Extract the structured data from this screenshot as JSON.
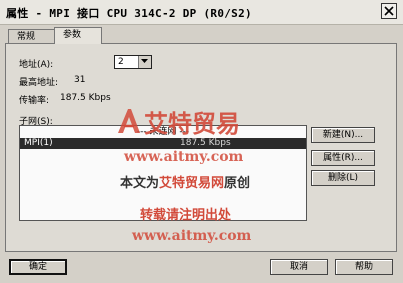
{
  "window": {
    "title": "属性 - MPI 接口  CPU 314C-2 DP (R0/S2)"
  },
  "tabs": [
    {
      "label": "常规"
    },
    {
      "label": "参数"
    }
  ],
  "params": {
    "address_label": "地址(A):",
    "address_value": "2",
    "highest_address_label": "最高地址:",
    "highest_address_value": "31",
    "baud_label": "传输率:",
    "baud_value": "187.5 Kbps",
    "subnet_label": "子网(S):"
  },
  "subnet_list": {
    "rows": [
      {
        "name": "--- 未连网 ---",
        "speed": ""
      },
      {
        "name": "MPI(1)",
        "speed": "187.5 Kbps"
      }
    ],
    "selected_index": 1
  },
  "side_buttons": {
    "new": "新建(N)...",
    "properties": "属性(R)...",
    "delete": "删除(L)"
  },
  "footer": {
    "ok": "确定",
    "cancel": "取消",
    "help": "帮助"
  },
  "watermark": {
    "brand": "艾特贸易",
    "url": "www.aitmy.com",
    "source_prefix": "本文为",
    "source_brand": "艾特贸易网",
    "source_suffix": "原创",
    "notice": "转载请注明出处"
  },
  "colors": {
    "dialog_bg": "#d4d0c8",
    "selection": "#2b2b2b",
    "watermark_red": "#d24a3a"
  }
}
